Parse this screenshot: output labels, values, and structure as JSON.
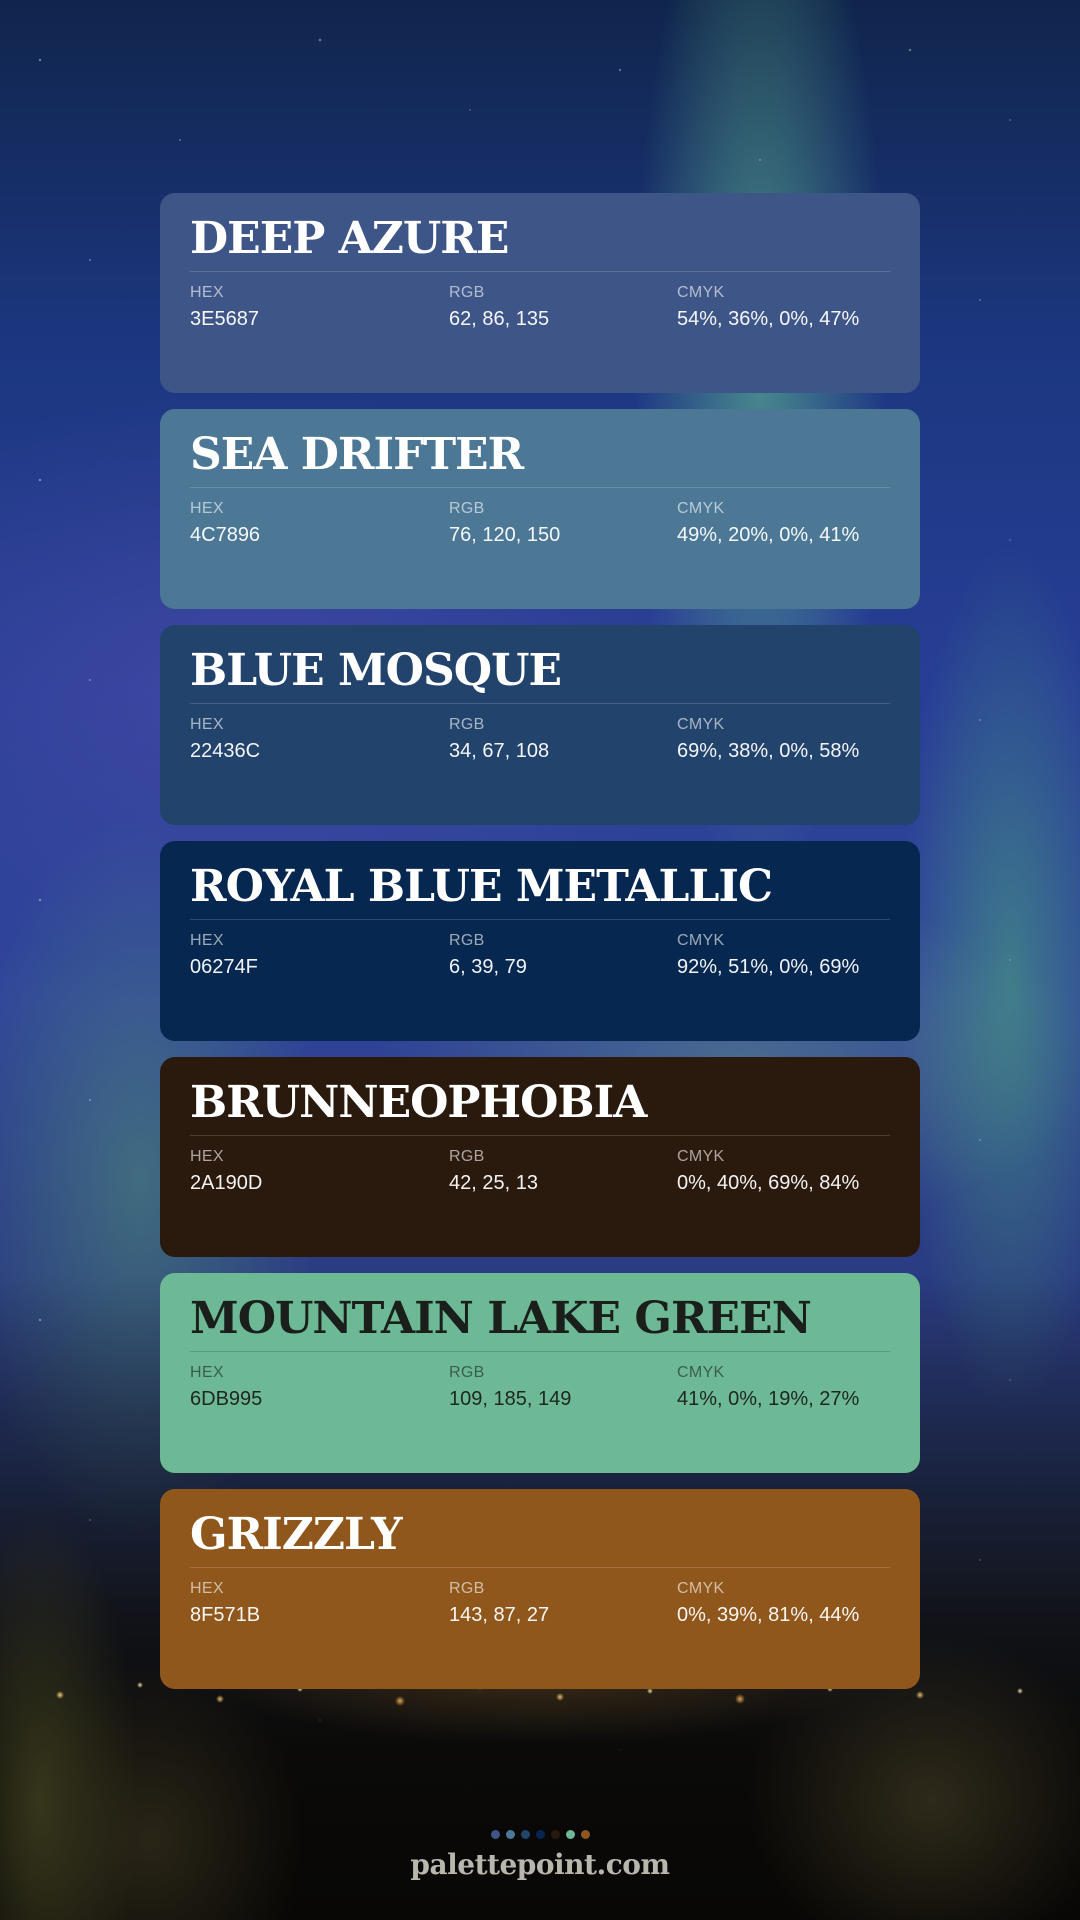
{
  "labels": {
    "hex": "HEX",
    "rgb": "RGB",
    "cmyk": "CMYK"
  },
  "colors": [
    {
      "name": "DEEP AZURE",
      "hex": "3E5687",
      "rgb": "62, 86, 135",
      "cmyk": "54%, 36%, 0%, 47%",
      "swatch": "#3E5687",
      "text_color": "#FFFFFF"
    },
    {
      "name": "SEA DRIFTER",
      "hex": "4C7896",
      "rgb": "76, 120, 150",
      "cmyk": "49%, 20%, 0%, 41%",
      "swatch": "#4C7896",
      "text_color": "#FFFFFF"
    },
    {
      "name": "BLUE MOSQUE",
      "hex": "22436C",
      "rgb": "34, 67, 108",
      "cmyk": "69%, 38%, 0%, 58%",
      "swatch": "#22436C",
      "text_color": "#FFFFFF"
    },
    {
      "name": "ROYAL BLUE METALLIC",
      "hex": "06274F",
      "rgb": "6, 39, 79",
      "cmyk": "92%, 51%, 0%, 69%",
      "swatch": "#06274F",
      "text_color": "#FFFFFF"
    },
    {
      "name": "BRUNNEOPHOBIA",
      "hex": "2A190D",
      "rgb": "42, 25, 13",
      "cmyk": "0%, 40%, 69%, 84%",
      "swatch": "#2A190D",
      "text_color": "#FFFFFF"
    },
    {
      "name": "MOUNTAIN LAKE GREEN",
      "hex": "6DB995",
      "rgb": "109, 185, 149",
      "cmyk": "41%, 0%, 19%, 27%",
      "swatch": "#6DB995",
      "text_color": "#1B1F1C"
    },
    {
      "name": "GRIZZLY",
      "hex": "8F571B",
      "rgb": "143, 87, 27",
      "cmyk": "0%, 39%, 81%, 44%",
      "swatch": "#8F571B",
      "text_color": "#FFFFFF"
    }
  ],
  "footer": {
    "website": "palettepoint.com"
  }
}
